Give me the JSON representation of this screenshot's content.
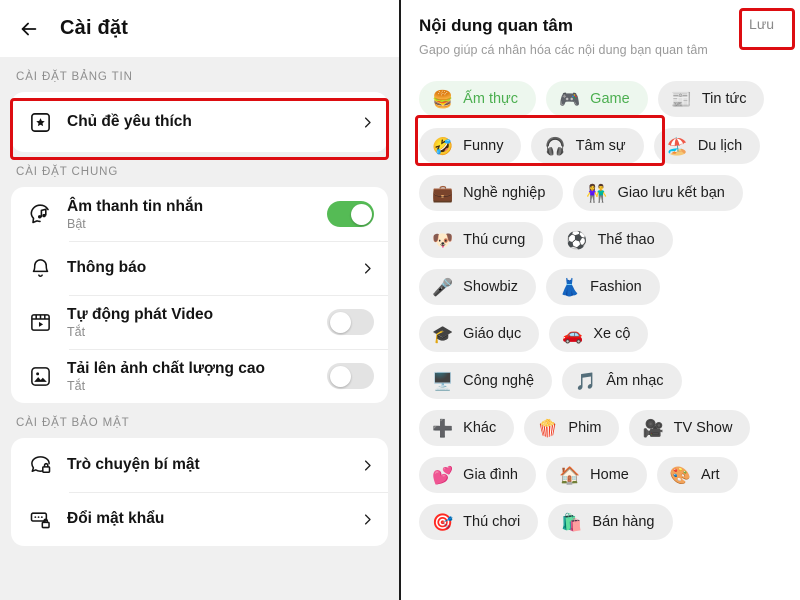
{
  "left": {
    "header": {
      "back_icon": "back-arrow-icon",
      "title": "Cài đặt"
    },
    "sections": [
      {
        "label": "CÀI ĐẶT BẢNG TIN",
        "rows": [
          {
            "icon": "star-box-icon",
            "title": "Chủ đề yêu thích",
            "sub": "",
            "control": "chevron",
            "highlight": true
          }
        ]
      },
      {
        "label": "CÀI ĐẶT CHUNG",
        "rows": [
          {
            "icon": "message-sound-icon",
            "title": "Âm thanh tin nhắn",
            "sub": "Bật",
            "control": "toggle-on",
            "highlight": false
          },
          {
            "icon": "bell-icon",
            "title": "Thông báo",
            "sub": "",
            "control": "chevron",
            "highlight": false
          },
          {
            "icon": "video-play-icon",
            "title": "Tự động phát Video",
            "sub": "Tắt",
            "control": "toggle-off",
            "highlight": false
          },
          {
            "icon": "photo-icon",
            "title": "Tải lên ảnh chất lượng cao",
            "sub": "Tắt",
            "control": "toggle-off",
            "highlight": false
          }
        ]
      },
      {
        "label": "CÀI ĐẶT BẢO MẬT",
        "rows": [
          {
            "icon": "secret-chat-icon",
            "title": "Trò chuyện bí mật",
            "sub": "",
            "control": "chevron",
            "highlight": false
          },
          {
            "icon": "password-lock-icon",
            "title": "Đổi mật khẩu",
            "sub": "",
            "control": "chevron",
            "highlight": false
          }
        ]
      }
    ]
  },
  "right": {
    "title": "Nội dung quan tâm",
    "subtitle": "Gapo giúp cá nhân hóa các nội dung bạn quan tâm",
    "save_label": "Lưu",
    "chips": [
      {
        "emoji": "🍔",
        "label": "Ấm thực",
        "selected": true
      },
      {
        "emoji": "🎮",
        "label": "Game",
        "selected": true
      },
      {
        "emoji": "📰",
        "label": "Tin tức",
        "selected": false
      },
      {
        "emoji": "🤣",
        "label": "Funny",
        "selected": false
      },
      {
        "emoji": "🎧",
        "label": "Tâm sự",
        "selected": false
      },
      {
        "emoji": "🏖️",
        "label": "Du lịch",
        "selected": false
      },
      {
        "emoji": "💼",
        "label": "Nghề nghiệp",
        "selected": false
      },
      {
        "emoji": "👫",
        "label": "Giao lưu kết bạn",
        "selected": false
      },
      {
        "emoji": "🐶",
        "label": "Thú cưng",
        "selected": false
      },
      {
        "emoji": "⚽",
        "label": "Thể thao",
        "selected": false
      },
      {
        "emoji": "🎤",
        "label": "Showbiz",
        "selected": false
      },
      {
        "emoji": "👗",
        "label": "Fashion",
        "selected": false
      },
      {
        "emoji": "🎓",
        "label": "Giáo dục",
        "selected": false
      },
      {
        "emoji": "🚗",
        "label": "Xe cộ",
        "selected": false
      },
      {
        "emoji": "🖥️",
        "label": "Công nghệ",
        "selected": false
      },
      {
        "emoji": "🎵",
        "label": "Âm nhạc",
        "selected": false
      },
      {
        "emoji": "➕",
        "label": "Khác",
        "selected": false
      },
      {
        "emoji": "🍿",
        "label": "Phim",
        "selected": false
      },
      {
        "emoji": "🎥",
        "label": "TV Show",
        "selected": false
      },
      {
        "emoji": "💕",
        "label": "Gia đình",
        "selected": false
      },
      {
        "emoji": "🏠",
        "label": "Home",
        "selected": false
      },
      {
        "emoji": "🎨",
        "label": "Art",
        "selected": false
      },
      {
        "emoji": "🎯",
        "label": "Thú chơi",
        "selected": false
      },
      {
        "emoji": "🛍️",
        "label": "Bán hàng",
        "selected": false
      }
    ]
  },
  "colors": {
    "highlight_red": "#dd0d11",
    "toggle_on_green": "#55bb55",
    "chip_selected_bg": "#edf7ee",
    "chip_selected_text": "#4caf50",
    "panel_bg": "#f0f0f0"
  }
}
